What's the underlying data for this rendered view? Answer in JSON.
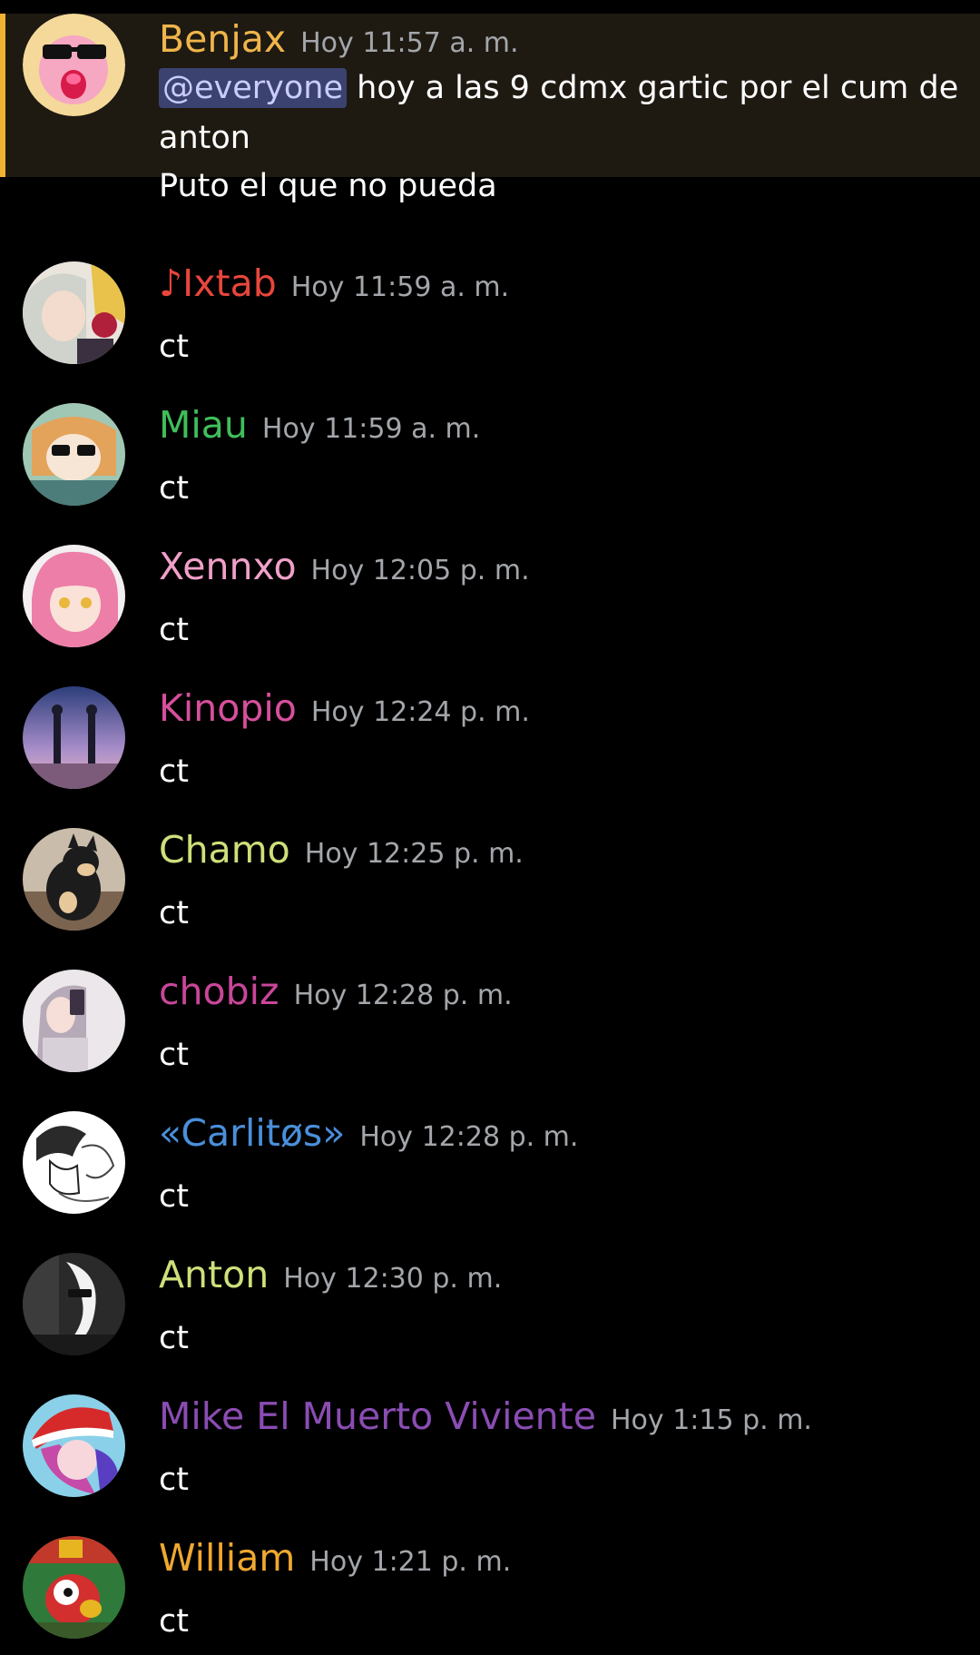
{
  "messages": [
    {
      "author": "Benjax",
      "author_color": "#f0b54b",
      "time": "Hoy 11:57 a. m.",
      "mention": "@everyone",
      "lines": [
        " hoy a las 9 cdmx gartic por el cum de",
        "anton",
        "Puto el que no pueda"
      ],
      "avatar_icon": "kirby-sunglasses-avatar"
    },
    {
      "author": "♪Ixtab",
      "author_color": "#e8463c",
      "time": "Hoy 11:59 a. m.",
      "text": "ct",
      "avatar_icon": "anime-girl-avatar"
    },
    {
      "author": "Miau",
      "author_color": "#3fbf5a",
      "time": "Hoy 11:59 a. m.",
      "text": "ct",
      "avatar_icon": "umaru-sunglasses-avatar"
    },
    {
      "author": "Xennxo",
      "author_color": "#f0a0c8",
      "time": "Hoy 12:05 p. m.",
      "text": "ct",
      "avatar_icon": "pink-hair-girl-avatar"
    },
    {
      "author": "Kinopio",
      "author_color": "#d74f9c",
      "time": "Hoy 12:24 p. m.",
      "text": "ct",
      "avatar_icon": "sunset-scene-avatar"
    },
    {
      "author": "Chamo",
      "author_color": "#cde07a",
      "time": "Hoy 12:25 p. m.",
      "text": "ct",
      "avatar_icon": "shiba-dog-avatar"
    },
    {
      "author": "chobiz",
      "author_color": "#c9469a",
      "time": "Hoy 12:28 p. m.",
      "text": "ct",
      "avatar_icon": "selfie-girl-avatar"
    },
    {
      "author": "«Carlitøs»",
      "author_color": "#4a8fdb",
      "time": "Hoy 12:28 p. m.",
      "text": "ct",
      "avatar_icon": "manga-sketch-avatar"
    },
    {
      "author": "Anton",
      "author_color": "#cde07a",
      "time": "Hoy 12:30 p. m.",
      "text": "ct",
      "avatar_icon": "moon-man-avatar"
    },
    {
      "author": "Mike El Muerto Viviente",
      "author_color": "#8a4db3",
      "time": "Hoy 1:15 p. m.",
      "text": "ct",
      "avatar_icon": "santa-hat-anime-avatar"
    },
    {
      "author": "William",
      "author_color": "#f0a830",
      "time": "Hoy 1:21 p. m.",
      "text": "ct",
      "avatar_icon": "yoshi-avatar"
    }
  ]
}
